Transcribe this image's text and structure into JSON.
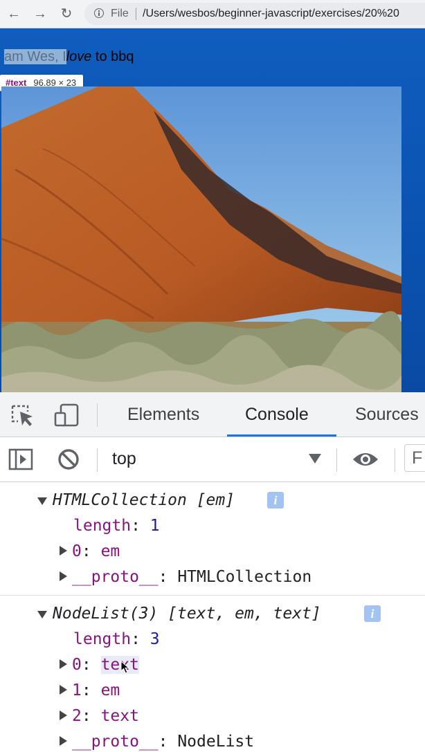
{
  "browser": {
    "back_icon": "←",
    "forward_icon": "→",
    "reload_icon": "↻",
    "scheme_label": "File",
    "url": "/Users/wesbos/beginner-javascript/exercises/20%20"
  },
  "page": {
    "highlighted_text": "am Wes, I",
    "em_text": "love",
    "rest_text": " to bbq",
    "tooltip_name": "#text",
    "tooltip_size": "96.89 × 23"
  },
  "devtools": {
    "tabs": [
      "Elements",
      "Console",
      "Sources"
    ],
    "active_tab": "Console",
    "context": "top",
    "filter_label": "F",
    "colors": {
      "accent": "#1a73e8",
      "property": "#881280",
      "number": "#1a1aa6"
    }
  },
  "console": {
    "entry1": {
      "title": "HTMLCollection [em]",
      "length_key": "length",
      "length_value": "1",
      "item0_key": "0",
      "item0_value": "em",
      "proto_key": "__proto__",
      "proto_value": "HTMLCollection"
    },
    "entry2": {
      "title": "NodeList(3) [text, em, text]",
      "length_key": "length",
      "length_value": "3",
      "item0_key": "0",
      "item0_value": "text",
      "item1_key": "1",
      "item1_value": "em",
      "item2_key": "2",
      "item2_value": "text",
      "proto_key": "__proto__",
      "proto_value": "NodeList"
    },
    "info_icon_label": "i"
  }
}
